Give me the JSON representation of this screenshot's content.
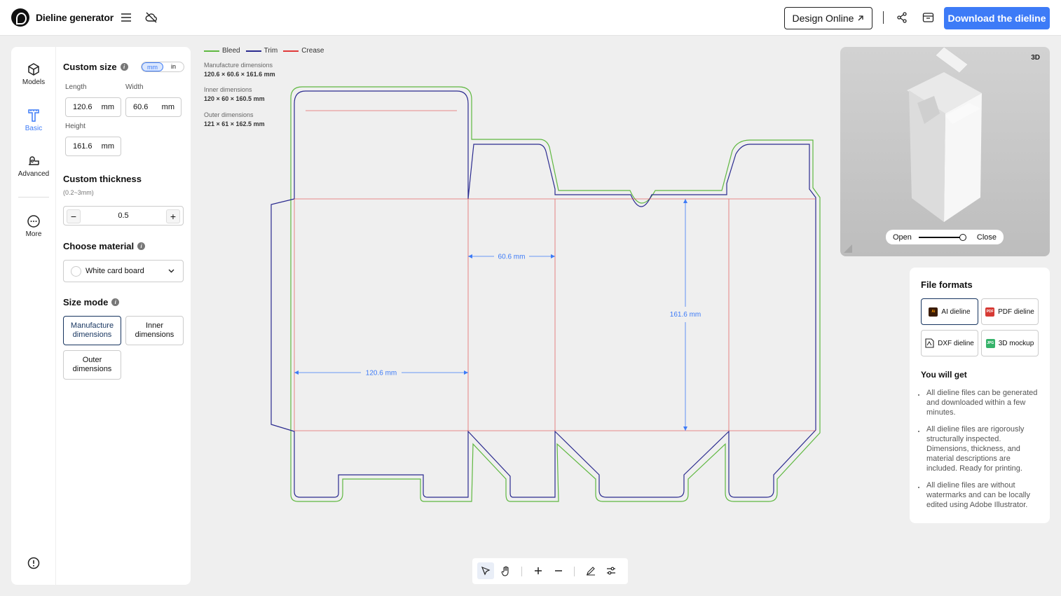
{
  "app": {
    "title": "Dieline generator"
  },
  "topbar": {
    "design_online": "Design Online",
    "download": "Download the dieline",
    "icons": [
      "menu-icon",
      "cloud-off-icon",
      "share-icon",
      "box-archive-icon",
      "external-link-icon"
    ]
  },
  "rail": {
    "items": [
      {
        "label": "Models",
        "icon": "cube-icon"
      },
      {
        "label": "Basic",
        "icon": "ruler-icon",
        "active": true
      },
      {
        "label": "Advanced",
        "icon": "advanced-shape-icon"
      },
      {
        "label": "More",
        "icon": "more-dots-icon"
      }
    ]
  },
  "size": {
    "title": "Custom size",
    "unit_mm": "mm",
    "unit_in": "in",
    "active_unit": "mm",
    "length_label": "Length",
    "length_value": "120.6",
    "width_label": "Width",
    "width_value": "60.6",
    "height_label": "Height",
    "height_value": "161.6",
    "unit_suffix": "mm"
  },
  "thickness": {
    "title": "Custom thickness",
    "range": "(0.2~3mm)",
    "value": "0.5",
    "minus": "−",
    "plus": "+"
  },
  "material": {
    "title": "Choose material",
    "selected": "White card board"
  },
  "size_mode": {
    "title": "Size mode",
    "options": [
      "Manufacture dimensions",
      "Inner dimensions",
      "Outer dimensions"
    ],
    "selected": "Manufacture dimensions"
  },
  "legend": {
    "bleed": "Bleed",
    "trim": "Trim",
    "crease": "Crease",
    "colors": {
      "bleed": "#5fb840",
      "trim": "#2b2b8f",
      "crease": "#e03a3a"
    }
  },
  "dimensions": {
    "manufacture_label": "Manufacture dimensions",
    "manufacture_value": "120.6 × 60.6 × 161.6 mm",
    "inner_label": "Inner dimensions",
    "inner_value": "120 × 60 × 160.5 mm",
    "outer_label": "Outer dimensions",
    "outer_value": "121 × 61 × 162.5 mm"
  },
  "dieline": {
    "length_label": "120.6 mm",
    "width_label": "60.6 mm",
    "height_label": "161.6 mm",
    "measure_color": "#3d7bf7"
  },
  "preview": {
    "badge": "3D",
    "open": "Open",
    "close": "Close",
    "slider_level": 0.9
  },
  "file_formats": {
    "title": "File formats",
    "items": [
      {
        "label": "AI dieline",
        "icon": "ai-file-icon"
      },
      {
        "label": "PDF dieline",
        "icon": "pdf-file-icon"
      },
      {
        "label": "DXF dieline",
        "icon": "dxf-file-icon"
      },
      {
        "label": "3D mockup",
        "icon": "jpg-file-icon"
      }
    ],
    "badge_ai": "Ai",
    "badge_pdf": "PDF",
    "badge_jpg": "JPG",
    "you_get_title": "You will get",
    "benefits": [
      "All dieline files can be generated and downloaded within a few minutes.",
      "All dieline files are rigorously structurally inspected. Dimensions, thickness, and material descriptions are included. Ready for printing.",
      "All dieline files are without watermarks and can be locally edited using Adobe Illustrator."
    ]
  },
  "brand_color": "#3d7bf7"
}
